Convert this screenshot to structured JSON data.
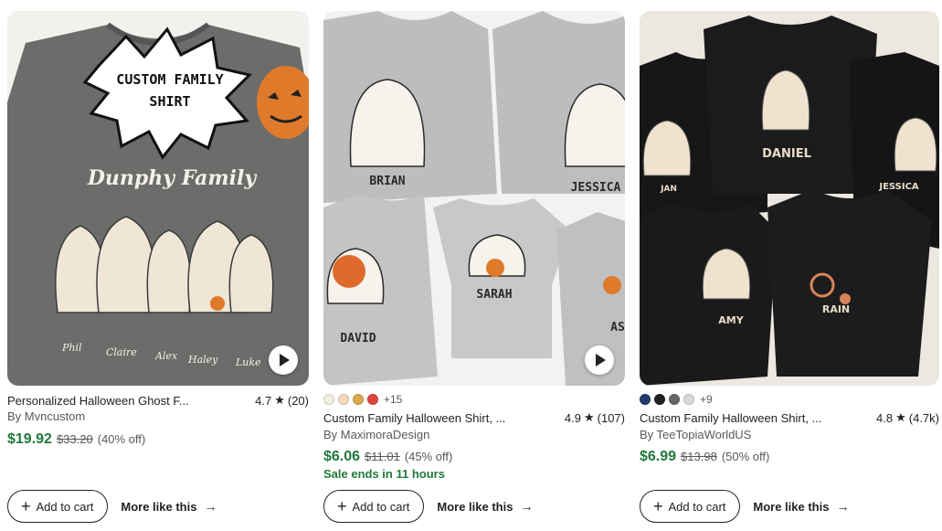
{
  "cards": [
    {
      "image_texts": [
        "CUSTOM FAMILY",
        "SHIRT",
        "Dunphy Family",
        "Phil",
        "Claire",
        "Alex",
        "Haley",
        "Luke"
      ],
      "has_video": true,
      "swatches": [],
      "swatch_more": "",
      "title": "Personalized Halloween Ghost F...",
      "rating": "4.7",
      "reviews": "(20)",
      "shop": "By Mvncustom",
      "price": "$19.92",
      "original_price": "$33.20",
      "discount": "(40% off)",
      "sale_ends": "",
      "add_to_cart": "Add to cart",
      "more_like_this": "More like this"
    },
    {
      "image_texts": [
        "BRIAN",
        "JESSICA",
        "DAVID",
        "SARAH",
        "AS"
      ],
      "has_video": true,
      "swatches": [
        "#f3efe3",
        "#f6d9bd",
        "#d8a94e",
        "#e0443e"
      ],
      "swatch_more": "+15",
      "title": "Custom Family Halloween Shirt, ...",
      "rating": "4.9",
      "reviews": "(107)",
      "shop": "By MaximoraDesign",
      "price": "$6.06",
      "original_price": "$11.01",
      "discount": "(45% off)",
      "sale_ends": "Sale ends in 11 hours",
      "add_to_cart": "Add to cart",
      "more_like_this": "More like this"
    },
    {
      "image_texts": [
        "DANIEL",
        "JAN",
        "JESSICA",
        "AMY",
        "RAIN"
      ],
      "has_video": false,
      "swatches": [
        "#1f3a6b",
        "#222222",
        "#666666",
        "#d9d9d9"
      ],
      "swatch_more": "+9",
      "title": "Custom Family Halloween Shirt, ...",
      "rating": "4.8",
      "reviews": "(4.7k)",
      "shop": "By TeeTopiaWorldUS",
      "price": "$6.99",
      "original_price": "$13.98",
      "discount": "(50% off)",
      "sale_ends": "",
      "add_to_cart": "Add to cart",
      "more_like_this": "More like this"
    }
  ],
  "icons": {
    "star": "★",
    "plus": "+",
    "arrow": "→"
  },
  "colors": {
    "price_green": "#1f7a39"
  }
}
